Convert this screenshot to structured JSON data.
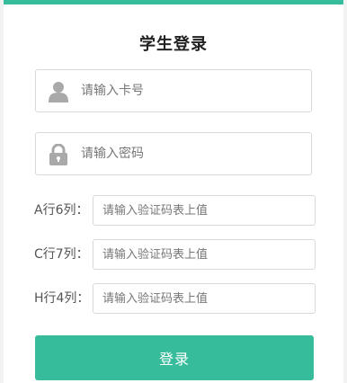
{
  "title": "学生登录",
  "card_field": {
    "placeholder": "请输入卡号",
    "value": "",
    "icon": "user-icon"
  },
  "password_field": {
    "placeholder": "请输入密码",
    "value": "",
    "icon": "lock-icon"
  },
  "captcha_rows": [
    {
      "label": "A行6列：",
      "placeholder": "请输入验证码表上值",
      "value": ""
    },
    {
      "label": "C行7列：",
      "placeholder": "请输入验证码表上值",
      "value": ""
    },
    {
      "label": "H行4列：",
      "placeholder": "请输入验证码表上值",
      "value": ""
    }
  ],
  "login_button": {
    "label": "登录"
  },
  "colors": {
    "accent": "#36bb9b",
    "icon": "#a9a9a9"
  }
}
